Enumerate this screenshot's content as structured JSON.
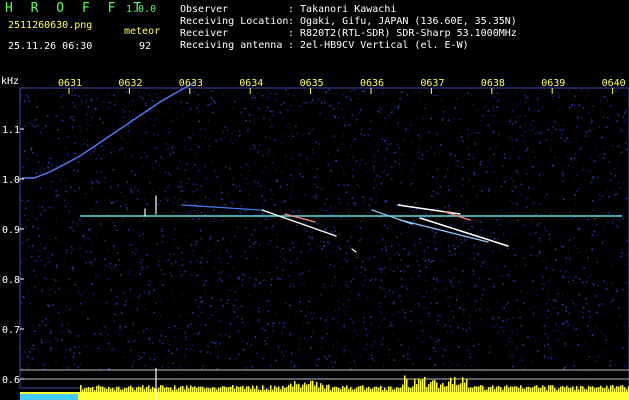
{
  "app": {
    "name": "H R O F F T",
    "version": "1.0.0"
  },
  "capture": {
    "filename": "2511260630.png",
    "datetime": "25.11.26 06:30",
    "meteor_label": "meteor",
    "meteor_count": "92"
  },
  "info": [
    {
      "key": "Observer",
      "value": ": Takanori Kawachi"
    },
    {
      "key": "Receiving Location",
      "value": ": Ogaki, Gifu, JAPAN (136.60E, 35.35N)"
    },
    {
      "key": "Receiver",
      "value": ": R820T2(RTL-SDR) SDR-Sharp 53.1000MHz"
    },
    {
      "key": "Receiving antenna",
      "value": ": 2el-HB9CV Vertical (el. E-W)"
    }
  ],
  "axes": {
    "y_unit": "kHz",
    "x_ticks": [
      "0631",
      "0632",
      "0633",
      "0634",
      "0635",
      "0636",
      "0637",
      "0638",
      "0639",
      "0640"
    ],
    "y_ticks": [
      "1.1",
      "1.0",
      "0.9",
      "0.8",
      "0.7",
      "0.6"
    ]
  },
  "colors": {
    "background": "#000000",
    "noise": "#1a2a8a",
    "text_green": "#55ff55",
    "text_yellow": "#ffff55",
    "carrier": "#55e0e0",
    "meteor_trail": "#ffffff"
  }
}
